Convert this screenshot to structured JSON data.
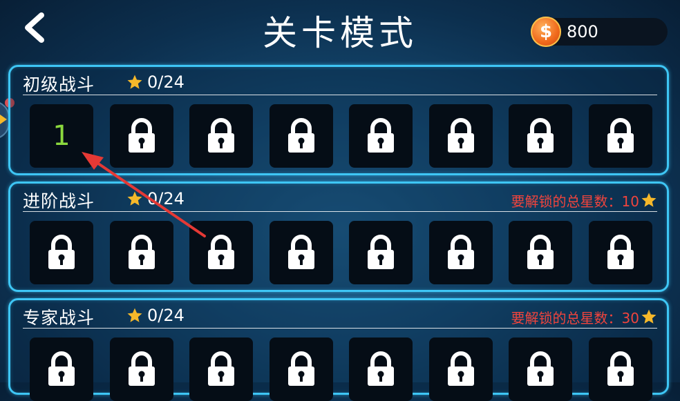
{
  "header": {
    "title": "关卡模式",
    "coins": "800",
    "coin_symbol": "$"
  },
  "sections": [
    {
      "title": "初级战斗",
      "stars": "0/24",
      "unlock_text": "",
      "levels": [
        {
          "state": "unlocked",
          "label": "1"
        },
        {
          "state": "locked",
          "label": ""
        },
        {
          "state": "locked",
          "label": ""
        },
        {
          "state": "locked",
          "label": ""
        },
        {
          "state": "locked",
          "label": ""
        },
        {
          "state": "locked",
          "label": ""
        },
        {
          "state": "locked",
          "label": ""
        },
        {
          "state": "locked",
          "label": ""
        }
      ]
    },
    {
      "title": "进阶战斗",
      "stars": "0/24",
      "unlock_text": "要解锁的总星数：10",
      "levels": [
        {
          "state": "locked",
          "label": ""
        },
        {
          "state": "locked",
          "label": ""
        },
        {
          "state": "locked",
          "label": ""
        },
        {
          "state": "locked",
          "label": ""
        },
        {
          "state": "locked",
          "label": ""
        },
        {
          "state": "locked",
          "label": ""
        },
        {
          "state": "locked",
          "label": ""
        },
        {
          "state": "locked",
          "label": ""
        }
      ]
    },
    {
      "title": "专家战斗",
      "stars": "0/24",
      "unlock_text": "要解锁的总星数：30",
      "levels": [
        {
          "state": "locked",
          "label": ""
        },
        {
          "state": "locked",
          "label": ""
        },
        {
          "state": "locked",
          "label": ""
        },
        {
          "state": "locked",
          "label": ""
        },
        {
          "state": "locked",
          "label": ""
        },
        {
          "state": "locked",
          "label": ""
        },
        {
          "state": "locked",
          "label": ""
        },
        {
          "state": "locked",
          "label": ""
        }
      ]
    }
  ],
  "colors": {
    "panel_border": "#3ec6f5",
    "unlock_text": "#f0443d",
    "level_number": "#8bd83e",
    "star": "#f5b82a",
    "annotation_arrow": "#e53935"
  }
}
